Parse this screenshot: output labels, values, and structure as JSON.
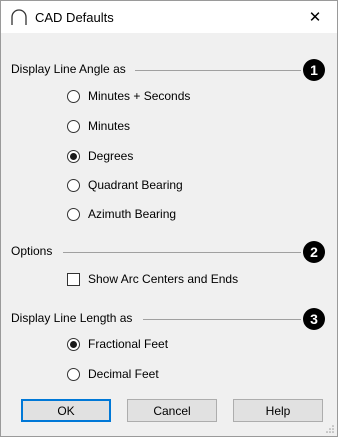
{
  "window": {
    "title": "CAD Defaults",
    "close_icon": "✕"
  },
  "groups": [
    {
      "label": "Display Line Angle as",
      "badge": "1",
      "options": [
        {
          "label": "Minutes + Seconds",
          "checked": false
        },
        {
          "label": "Minutes",
          "checked": false
        },
        {
          "label": "Degrees",
          "checked": true
        },
        {
          "label": "Quadrant Bearing",
          "checked": false
        },
        {
          "label": "Azimuth Bearing",
          "checked": false
        }
      ]
    },
    {
      "label": "Options",
      "badge": "2",
      "checkbox": {
        "label": "Show Arc Centers and Ends",
        "checked": false
      }
    },
    {
      "label": "Display Line Length as",
      "badge": "3",
      "options": [
        {
          "label": "Fractional Feet",
          "checked": true
        },
        {
          "label": "Decimal Feet",
          "checked": false
        }
      ]
    }
  ],
  "buttons": {
    "ok": "OK",
    "cancel": "Cancel",
    "help": "Help"
  }
}
